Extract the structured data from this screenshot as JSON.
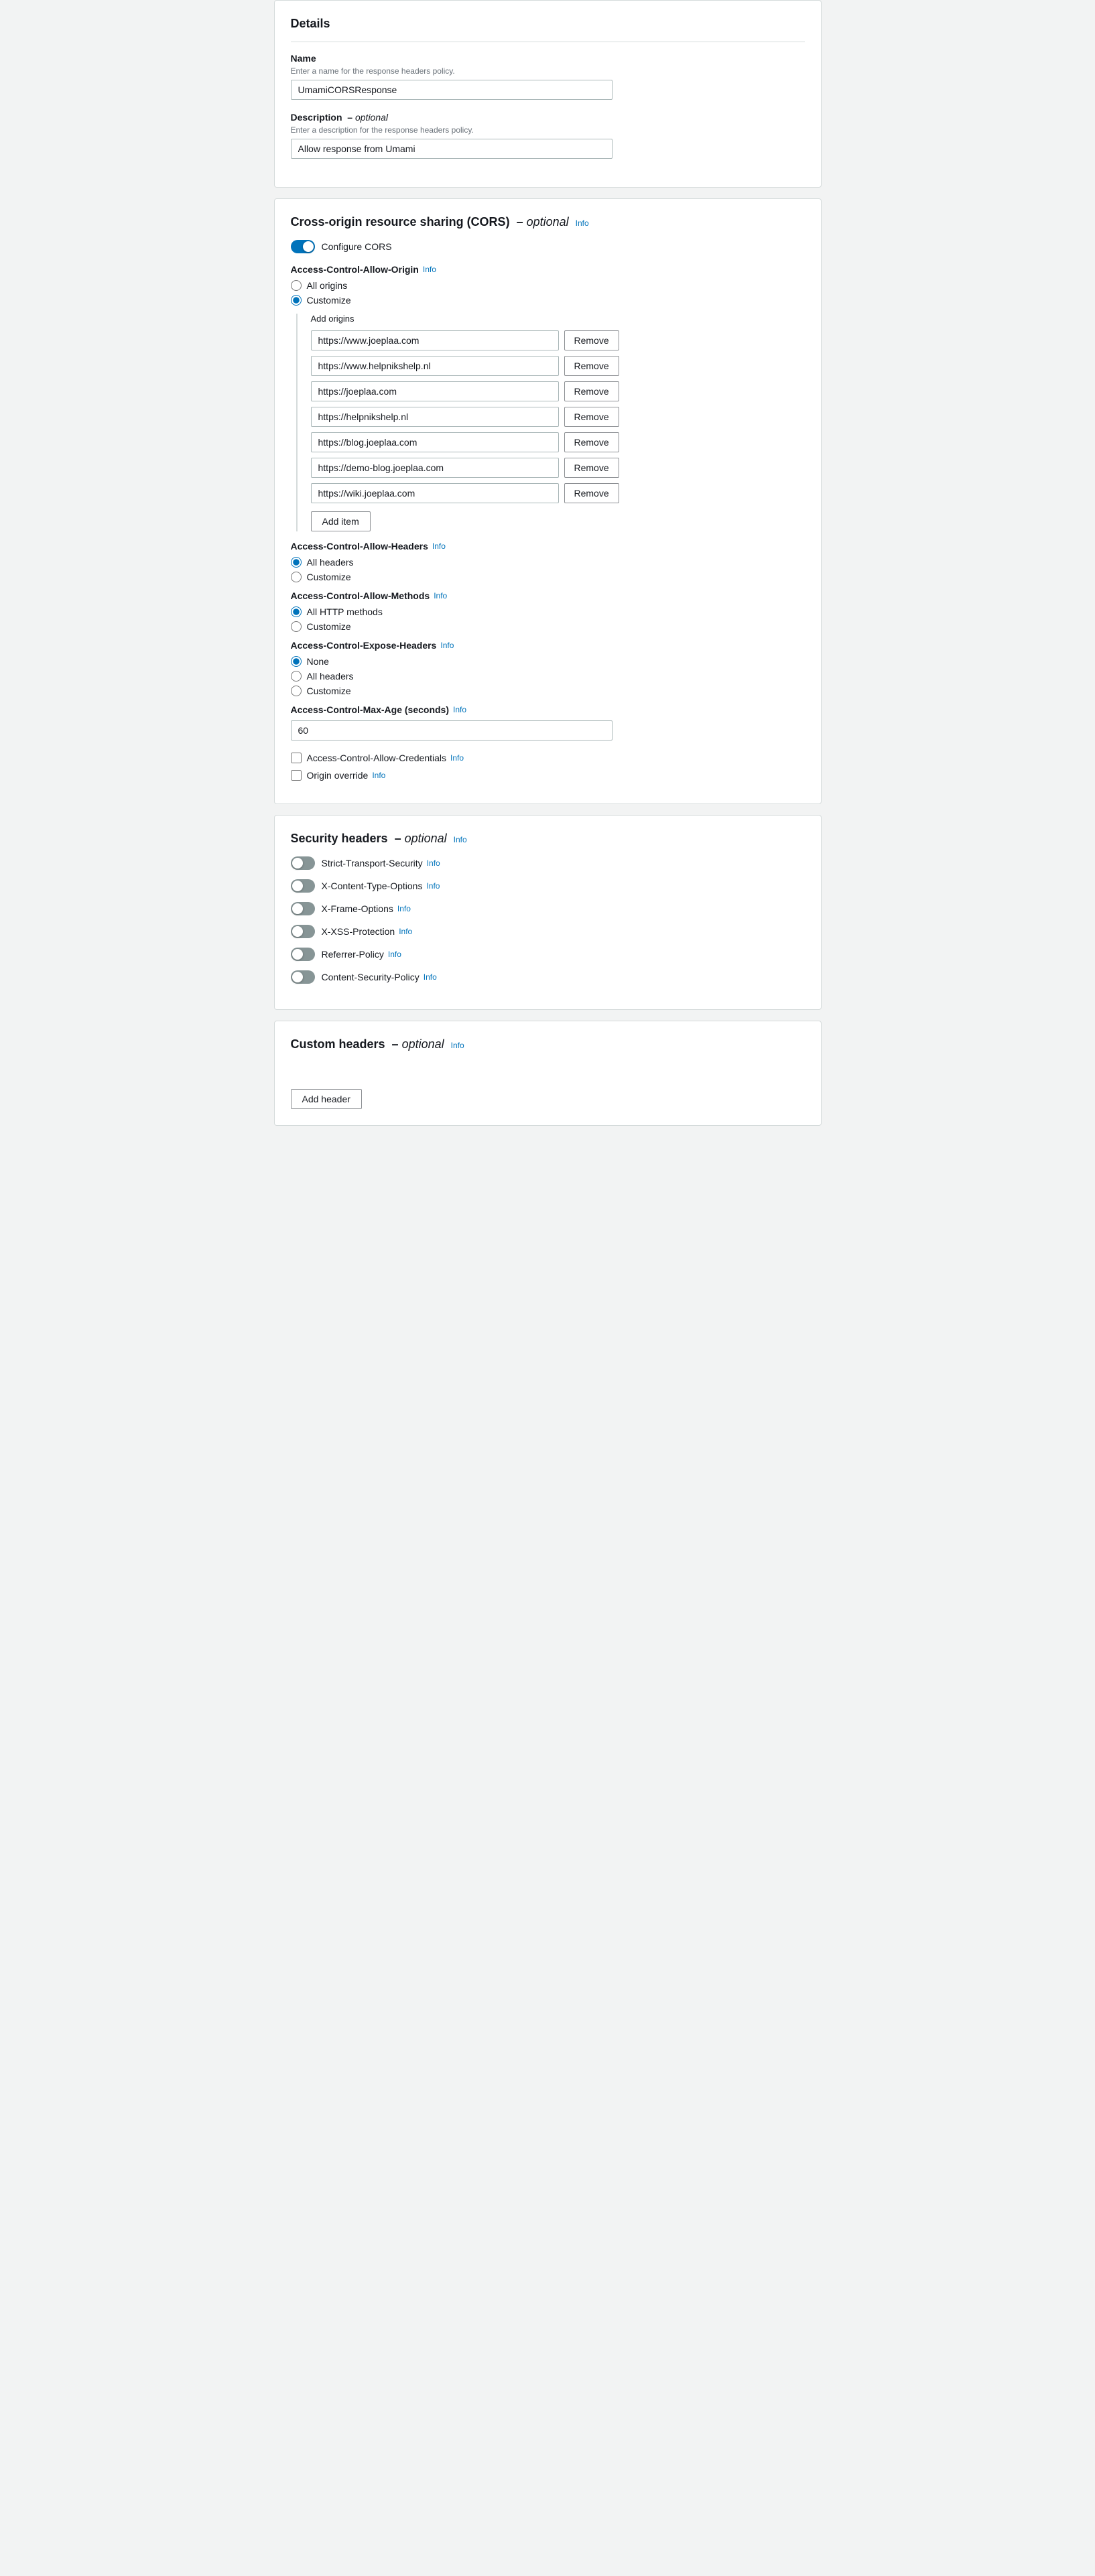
{
  "details": {
    "title": "Details",
    "name_label": "Name",
    "name_hint": "Enter a name for the response headers policy.",
    "name_value": "UmamiCORSResponse",
    "description_label": "Description",
    "description_optional": "optional",
    "description_hint": "Enter a description for the response headers policy.",
    "description_value": "Allow response from Umami"
  },
  "cors": {
    "title": "Cross-origin resource sharing (CORS)",
    "title_optional": "optional",
    "info_text": "Info",
    "configure_cors_label": "Configure CORS",
    "configure_cors_enabled": true,
    "access_control_allow_origin_label": "Access-Control-Allow-Origin",
    "origin_options": [
      "All origins",
      "Customize"
    ],
    "origin_selected": "Customize",
    "add_origins_label": "Add origins",
    "origins": [
      "https://www.joeplaa.com",
      "https://www.helpnikshelp.nl",
      "https://joeplaa.com",
      "https://helpnikshelp.nl",
      "https://blog.joeplaa.com",
      "https://demo-blog.joeplaa.com",
      "https://wiki.joeplaa.com"
    ],
    "remove_label": "Remove",
    "add_item_label": "Add item",
    "access_control_allow_headers_label": "Access-Control-Allow-Headers",
    "headers_options": [
      "All headers",
      "Customize"
    ],
    "headers_selected": "All headers",
    "access_control_allow_methods_label": "Access-Control-Allow-Methods",
    "methods_options": [
      "All HTTP methods",
      "Customize"
    ],
    "methods_selected": "All HTTP methods",
    "access_control_expose_headers_label": "Access-Control-Expose-Headers",
    "expose_options": [
      "None",
      "All headers",
      "Customize"
    ],
    "expose_selected": "None",
    "access_control_max_age_label": "Access-Control-Max-Age (seconds)",
    "max_age_value": "60",
    "access_control_allow_credentials_label": "Access-Control-Allow-Credentials",
    "access_control_allow_credentials_checked": false,
    "origin_override_label": "Origin override",
    "origin_override_checked": false
  },
  "security_headers": {
    "title": "Security headers",
    "title_optional": "optional",
    "info_text": "Info",
    "items": [
      {
        "label": "Strict-Transport-Security",
        "enabled": false
      },
      {
        "label": "X-Content-Type-Options",
        "enabled": false
      },
      {
        "label": "X-Frame-Options",
        "enabled": false
      },
      {
        "label": "X-XSS-Protection",
        "enabled": false
      },
      {
        "label": "Referrer-Policy",
        "enabled": false
      },
      {
        "label": "Content-Security-Policy",
        "enabled": false
      }
    ],
    "info_link": "Info"
  },
  "custom_headers": {
    "title": "Custom headers",
    "title_optional": "optional",
    "info_text": "Info",
    "add_header_label": "Add header"
  }
}
